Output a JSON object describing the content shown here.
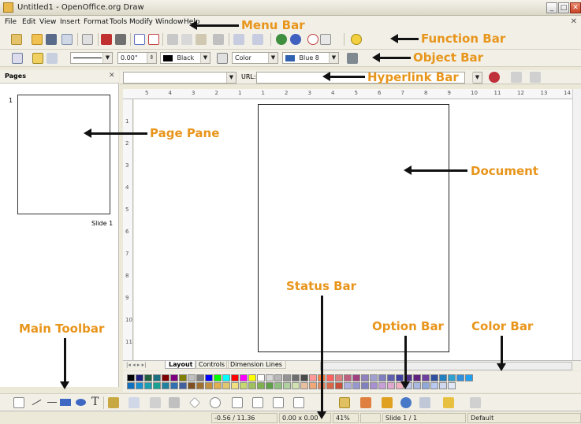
{
  "window": {
    "title": "Untitled1 - OpenOffice.org Draw"
  },
  "menu": [
    "File",
    "Edit",
    "View",
    "Insert",
    "Format",
    "Tools",
    "Modify",
    "Window",
    "Help"
  ],
  "object_bar": {
    "line_width": "0.00\"",
    "line_color": "Black",
    "area_style": "Color",
    "area_color": "Blue 8"
  },
  "hyperlink_bar": {
    "url_label": "URL:"
  },
  "pages_pane": {
    "title": "Pages",
    "page_number": "1",
    "slide_label": "Slide 1"
  },
  "ruler": {
    "h_ticks": [
      "5",
      "4",
      "3",
      "2",
      "1",
      "1",
      "2",
      "3",
      "4",
      "5",
      "6",
      "7",
      "8",
      "9",
      "10",
      "11",
      "12",
      "13",
      "14"
    ],
    "v_ticks": [
      "1",
      "2",
      "3",
      "4",
      "5",
      "6",
      "7",
      "8",
      "9",
      "10",
      "11"
    ]
  },
  "tabs": [
    "Layout",
    "Controls",
    "Dimension Lines"
  ],
  "status": {
    "position": "-0.56 / 11.36",
    "size": "0.00 x 0.00",
    "zoom": "41%",
    "slide": "Slide 1 / 1",
    "style": "Default"
  },
  "annotations": {
    "menu_bar": "Menu Bar",
    "function_bar": "Function Bar",
    "object_bar": "Object Bar",
    "hyperlink_bar": "Hyperlink  Bar",
    "page_pane": "Page Pane",
    "document": "Document",
    "status_bar": "Status Bar",
    "main_toolbar": "Main Toolbar",
    "option_bar": "Option Bar",
    "color_bar": "Color Bar"
  },
  "colors": {
    "annotation": "#e8951b",
    "palette_row1": [
      "#000000",
      "#1f1f80",
      "#206040",
      "#1a6f80",
      "#7f0000",
      "#7f007f",
      "#807f00",
      "#c0c0c0",
      "#808080",
      "#0000ff",
      "#00ff00",
      "#00ffff",
      "#ff0000",
      "#ff00ff",
      "#ffff00",
      "#ffffff",
      "#d8d8d8",
      "#b7b7b7",
      "#939393",
      "#6e6e6e",
      "#4a4a4a",
      "#ff9999",
      "#ff8040",
      "#ff6060",
      "#d98080",
      "#c06080",
      "#a04080",
      "#9080c0",
      "#a0a0d0",
      "#8080c0",
      "#6060b0",
      "#4040a0",
      "#503088",
      "#602080",
      "#7040a0",
      "#3050a0",
      "#2080c0",
      "#30a0d0",
      "#3090e0",
      "#20a0f0"
    ],
    "palette_row2": [
      "#1070c0",
      "#1890d0",
      "#1aa0b0",
      "#18a090",
      "#2080a0",
      "#3070b0",
      "#4060a0",
      "#805020",
      "#a07030",
      "#c09040",
      "#e0b050",
      "#e0c870",
      "#f0e080",
      "#c8d870",
      "#a0c060",
      "#80b050",
      "#60a048",
      "#90c080",
      "#b0d0a0",
      "#d0e0b0",
      "#e8c0a0",
      "#f0a878",
      "#e88860",
      "#d86848",
      "#c85038",
      "#b0b0e0",
      "#9898d0",
      "#8080c0",
      "#a890d0",
      "#c8a0d8",
      "#e0a8d0",
      "#f0b0c0",
      "#c0c8e8",
      "#a8b8e0",
      "#90a8d8",
      "#b8c8f0",
      "#d0d8f0",
      "#e0e8f8"
    ]
  }
}
